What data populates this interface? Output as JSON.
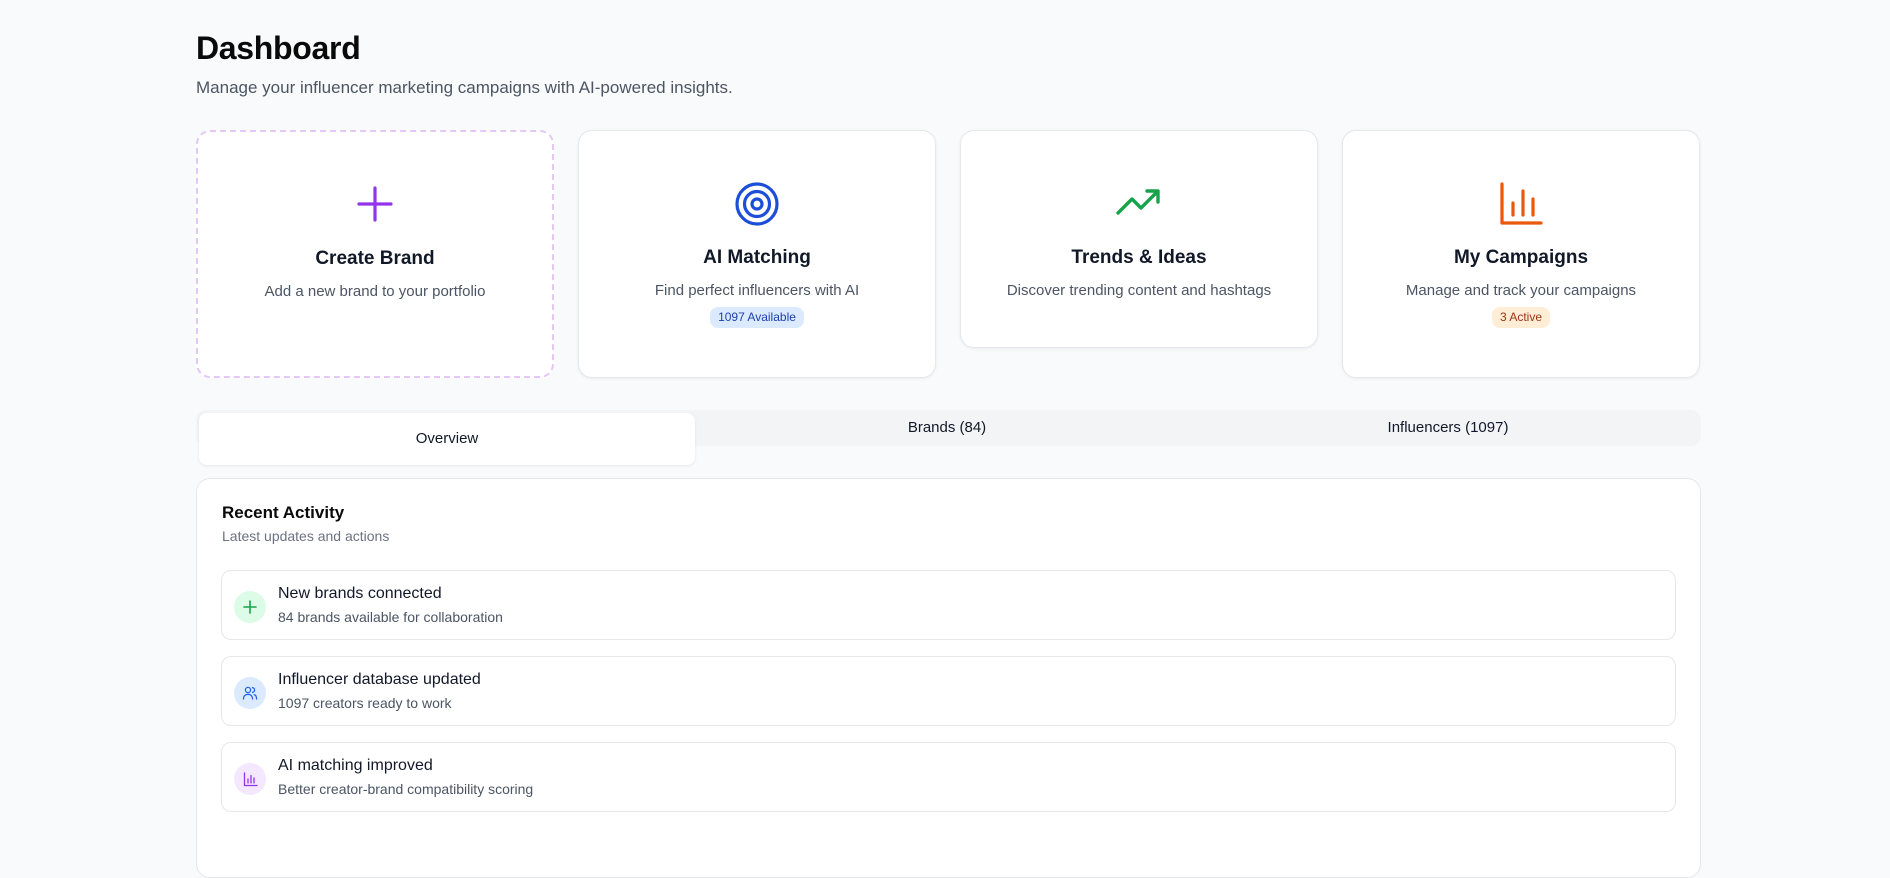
{
  "header": {
    "title": "Dashboard",
    "subtitle": "Manage your influencer marketing campaigns with AI-powered insights."
  },
  "cards": [
    {
      "title": "Create Brand",
      "description": "Add a new brand to your portfolio",
      "icon": "plus-icon",
      "color": "#9333ea"
    },
    {
      "title": "AI Matching",
      "description": "Find perfect influencers with AI",
      "badge": "1097 Available",
      "icon": "target-icon",
      "color": "#1d4ed8"
    },
    {
      "title": "Trends & Ideas",
      "description": "Discover trending content and hashtags",
      "icon": "trending-up-icon",
      "color": "#16a34a"
    },
    {
      "title": "My Campaigns",
      "description": "Manage and track your campaigns",
      "badge": "3 Active",
      "icon": "bar-chart-icon",
      "color": "#ea580c"
    }
  ],
  "tabs": [
    {
      "label": "Overview",
      "active": true
    },
    {
      "label": "Brands (84)",
      "active": false
    },
    {
      "label": "Influencers (1097)",
      "active": false
    }
  ],
  "activity": {
    "title": "Recent Activity",
    "subtitle": "Latest updates and actions",
    "items": [
      {
        "title": "New brands connected",
        "subtitle": "84 brands available for collaboration",
        "icon": "plus-icon",
        "color": "#16a34a"
      },
      {
        "title": "Influencer database updated",
        "subtitle": "1097 creators ready to work",
        "icon": "users-icon",
        "color": "#2563eb"
      },
      {
        "title": "AI matching improved",
        "subtitle": "Better creator-brand compatibility scoring",
        "icon": "bar-chart-icon",
        "color": "#9333ea"
      }
    ]
  }
}
